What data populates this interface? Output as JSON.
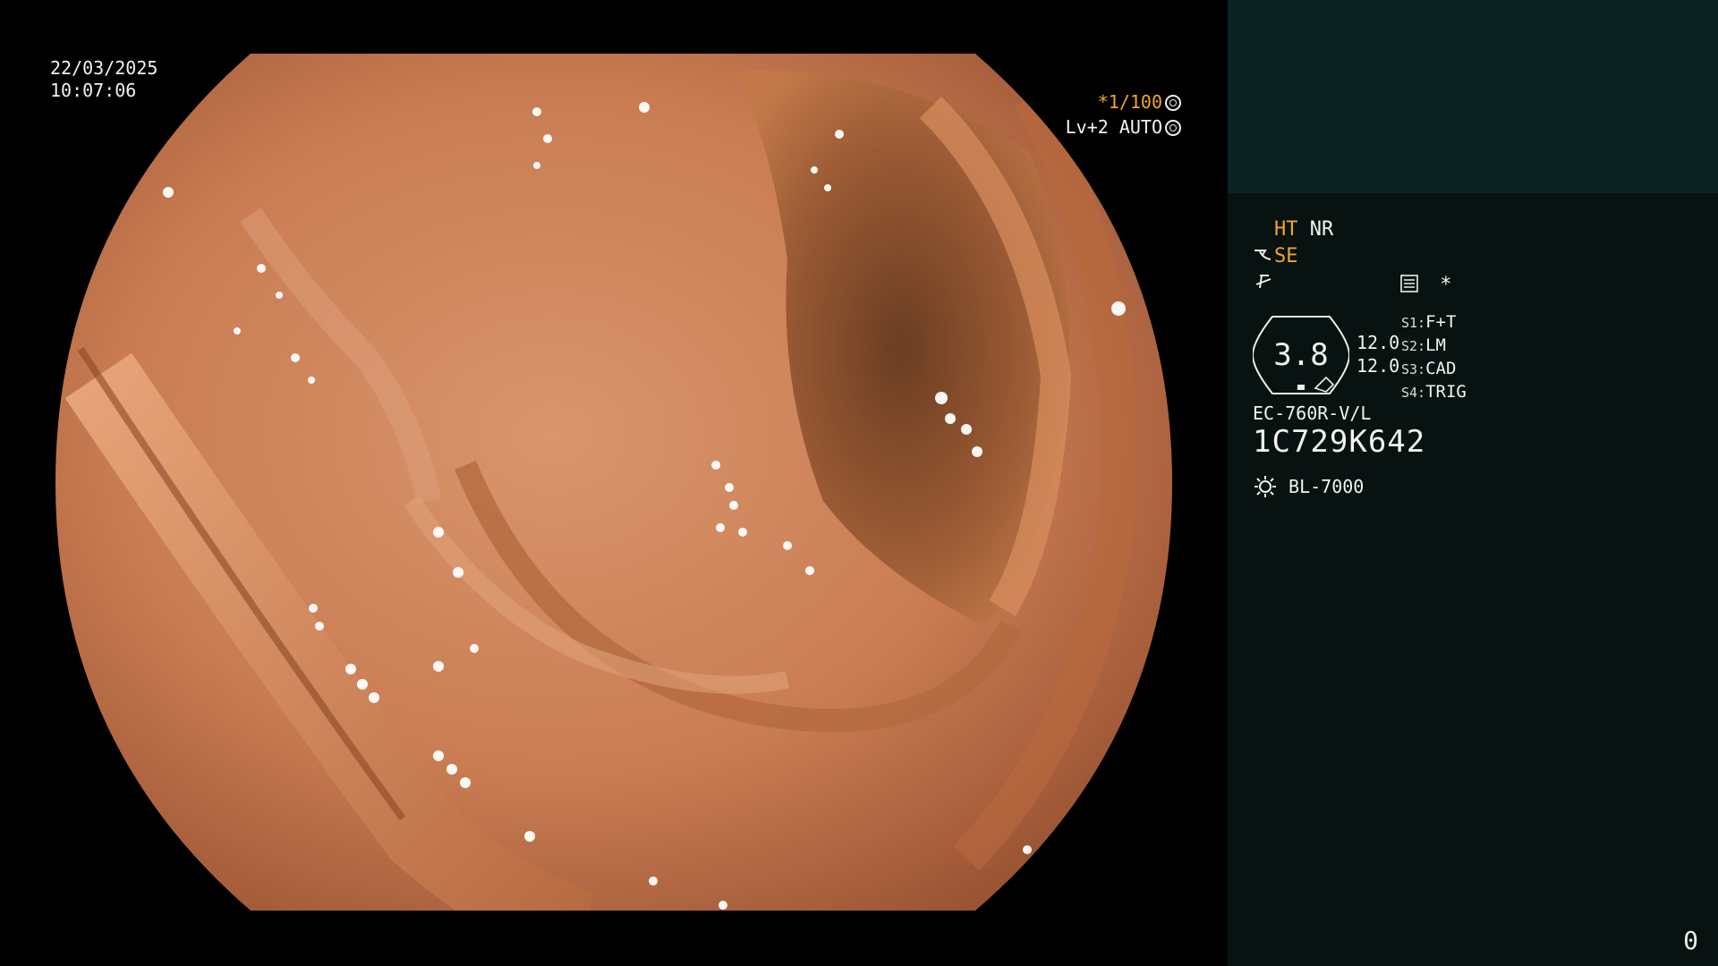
{
  "timestamp": {
    "date": "22/03/2025",
    "time": "10:07:06"
  },
  "shutter": {
    "speed": "*1/100",
    "level": "Lv+2 AUTO"
  },
  "panel": {
    "ht": "HT",
    "nr": "NR",
    "se": "SE",
    "scale_value": "3.8",
    "values": [
      "12.0",
      "12.0"
    ],
    "switches": [
      {
        "key": "S1:",
        "value": "F+T"
      },
      {
        "key": "S2:",
        "value": "LM"
      },
      {
        "key": "S3:",
        "value": "CAD"
      },
      {
        "key": "S4:",
        "value": "TRIG"
      }
    ],
    "scope_model": "EC-760R-V/L",
    "serial": "1C729K642",
    "light_source": "BL-7000",
    "asterisk": "*"
  },
  "page_number": "0",
  "icons": [
    "shutter-icon",
    "auto-icon",
    "scope-icon",
    "no-freeze-icon",
    "settings-icon",
    "light-source-icon"
  ],
  "colors": {
    "accent": "#f0a52c",
    "panel_bg": "#081211",
    "panel_top": "#0c2122"
  }
}
